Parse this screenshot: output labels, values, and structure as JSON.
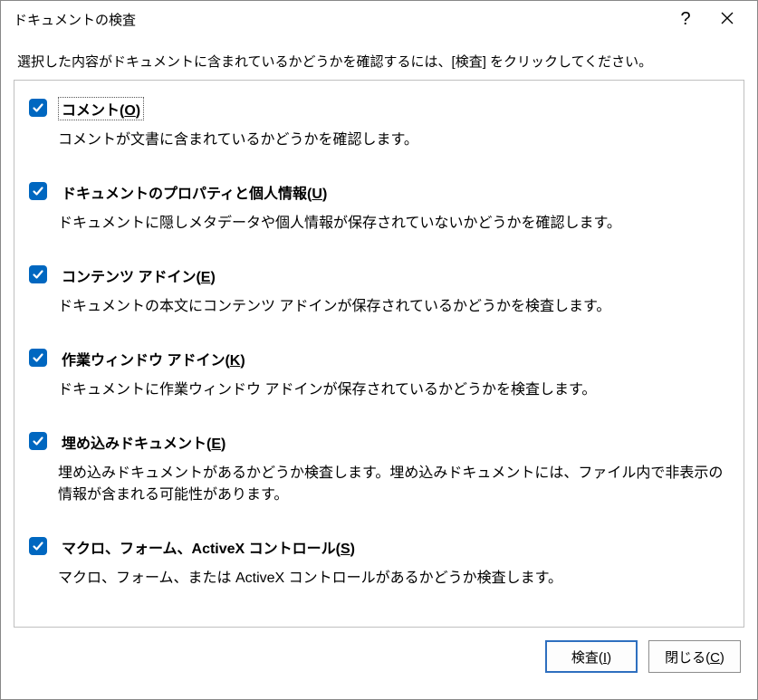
{
  "title": "ドキュメントの検査",
  "help_label": "?",
  "instruction": "選択した内容がドキュメントに含まれているかどうかを確認するには、[検査] をクリックしてください。",
  "items": [
    {
      "title_pre": "コメント(",
      "title_u": "O",
      "title_post": ")",
      "desc": "コメントが文書に含まれているかどうかを確認します。",
      "checked": true,
      "focused": true
    },
    {
      "title_pre": "ドキュメントのプロパティと個人情報(",
      "title_u": "U",
      "title_post": ")",
      "desc": "ドキュメントに隠しメタデータや個人情報が保存されていないかどうかを確認します。",
      "checked": true,
      "focused": false
    },
    {
      "title_pre": "コンテンツ アドイン(",
      "title_u": "E",
      "title_post": ")",
      "desc": "ドキュメントの本文にコンテンツ アドインが保存されているかどうかを検査します。",
      "checked": true,
      "focused": false
    },
    {
      "title_pre": "作業ウィンドウ アドイン(",
      "title_u": "K",
      "title_post": ")",
      "desc": "ドキュメントに作業ウィンドウ アドインが保存されているかどうかを検査します。",
      "checked": true,
      "focused": false
    },
    {
      "title_pre": "埋め込みドキュメント(",
      "title_u": "E",
      "title_post": ")",
      "desc": "埋め込みドキュメントがあるかどうか検査します。埋め込みドキュメントには、ファイル内で非表示の情報が含まれる可能性があります。",
      "checked": true,
      "focused": false
    },
    {
      "title_pre": "マクロ、フォーム、ActiveX コントロール(",
      "title_u": "S",
      "title_post": ")",
      "desc": "マクロ、フォーム、または ActiveX コントロールがあるかどうか検査します。",
      "checked": true,
      "focused": false
    }
  ],
  "buttons": {
    "inspect_pre": "検査(",
    "inspect_u": "I",
    "inspect_post": ")",
    "close_pre": "閉じる(",
    "close_u": "C",
    "close_post": ")"
  }
}
